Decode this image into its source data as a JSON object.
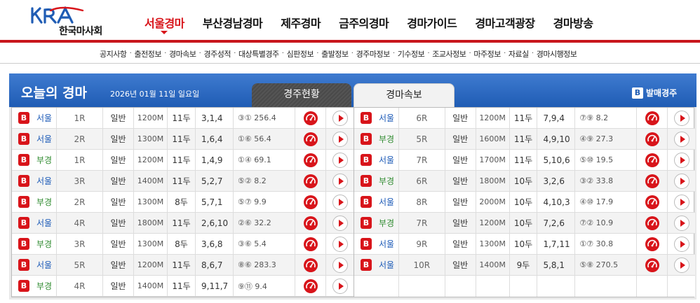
{
  "brand": {
    "logo_text": "KRA",
    "org_name": "한국마사회"
  },
  "gnb": [
    {
      "label": "서울경마",
      "active": true
    },
    {
      "label": "부산경남경마",
      "active": false
    },
    {
      "label": "제주경마",
      "active": false
    },
    {
      "label": "금주의경마",
      "active": false
    },
    {
      "label": "경마가이드",
      "active": false
    },
    {
      "label": "경마고객광장",
      "active": false
    },
    {
      "label": "경마방송",
      "active": false
    }
  ],
  "sub_nav": [
    "공지사항",
    "출전정보",
    "경마속보",
    "경주성적",
    "대상특별경주",
    "심판정보",
    "출발정보",
    "경주마정보",
    "기수정보",
    "조교사정보",
    "마주정보",
    "자료실",
    "경마시행정보"
  ],
  "panel": {
    "title": "오늘의 경마",
    "date": "2026년 01월 11일 일요일",
    "tabs": [
      "경주현황",
      "경마속보"
    ],
    "bet_badge": "B",
    "bet_link": "발매경주"
  },
  "colors": {
    "brand_red": "#d8141a",
    "header_blue": "#2a68c2",
    "seoul": "#1d5bb7",
    "busan": "#2e8a2e"
  },
  "icons": {
    "badge": "b-badge-icon",
    "live": "speedometer-icon",
    "play": "play-icon"
  },
  "races_left": [
    {
      "badge": "B",
      "venue": "서울",
      "race": "1R",
      "grade": "일반",
      "distance": "1200M",
      "count": "11두",
      "order": "3,1,4",
      "odds": "③① 256.4"
    },
    {
      "badge": "B",
      "venue": "서울",
      "race": "2R",
      "grade": "일반",
      "distance": "1300M",
      "count": "11두",
      "order": "1,6,4",
      "odds": "①⑥ 56.4"
    },
    {
      "badge": "B",
      "venue": "부경",
      "race": "1R",
      "grade": "일반",
      "distance": "1200M",
      "count": "11두",
      "order": "1,4,9",
      "odds": "①④ 69.1"
    },
    {
      "badge": "B",
      "venue": "서울",
      "race": "3R",
      "grade": "일반",
      "distance": "1400M",
      "count": "11두",
      "order": "5,2,7",
      "odds": "⑤② 8.2"
    },
    {
      "badge": "B",
      "venue": "부경",
      "race": "2R",
      "grade": "일반",
      "distance": "1300M",
      "count": "8두",
      "order": "5,7,1",
      "odds": "⑤⑦ 9.9"
    },
    {
      "badge": "B",
      "venue": "서울",
      "race": "4R",
      "grade": "일반",
      "distance": "1800M",
      "count": "11두",
      "order": "2,6,10",
      "odds": "②⑥ 32.2"
    },
    {
      "badge": "B",
      "venue": "부경",
      "race": "3R",
      "grade": "일반",
      "distance": "1300M",
      "count": "8두",
      "order": "3,6,8",
      "odds": "③⑥ 5.4"
    },
    {
      "badge": "B",
      "venue": "서울",
      "race": "5R",
      "grade": "일반",
      "distance": "1200M",
      "count": "11두",
      "order": "8,6,7",
      "odds": "⑧⑥ 283.3"
    },
    {
      "badge": "B",
      "venue": "부경",
      "race": "4R",
      "grade": "일반",
      "distance": "1400M",
      "count": "11두",
      "order": "9,11,7",
      "odds": "⑨⑪ 9.4"
    }
  ],
  "races_right": [
    {
      "badge": "B",
      "venue": "서울",
      "race": "6R",
      "grade": "일반",
      "distance": "1200M",
      "count": "11두",
      "order": "7,9,4",
      "odds": "⑦⑨ 8.2"
    },
    {
      "badge": "B",
      "venue": "부경",
      "race": "5R",
      "grade": "일반",
      "distance": "1600M",
      "count": "11두",
      "order": "4,9,10",
      "odds": "④⑨ 27.3"
    },
    {
      "badge": "B",
      "venue": "서울",
      "race": "7R",
      "grade": "일반",
      "distance": "1700M",
      "count": "11두",
      "order": "5,10,6",
      "odds": "⑤⑩ 19.5"
    },
    {
      "badge": "B",
      "venue": "부경",
      "race": "6R",
      "grade": "일반",
      "distance": "1800M",
      "count": "10두",
      "order": "3,2,6",
      "odds": "③② 33.8"
    },
    {
      "badge": "B",
      "venue": "서울",
      "race": "8R",
      "grade": "일반",
      "distance": "2000M",
      "count": "10두",
      "order": "4,10,3",
      "odds": "④⑩ 17.9"
    },
    {
      "badge": "B",
      "venue": "부경",
      "race": "7R",
      "grade": "일반",
      "distance": "1200M",
      "count": "10두",
      "order": "7,2,6",
      "odds": "⑦② 10.9"
    },
    {
      "badge": "B",
      "venue": "서울",
      "race": "9R",
      "grade": "일반",
      "distance": "1300M",
      "count": "10두",
      "order": "1,7,11",
      "odds": "①⑦ 30.8"
    },
    {
      "badge": "B",
      "venue": "서울",
      "race": "10R",
      "grade": "일반",
      "distance": "1400M",
      "count": "9두",
      "order": "5,8,1",
      "odds": "⑤⑧ 270.5"
    }
  ]
}
